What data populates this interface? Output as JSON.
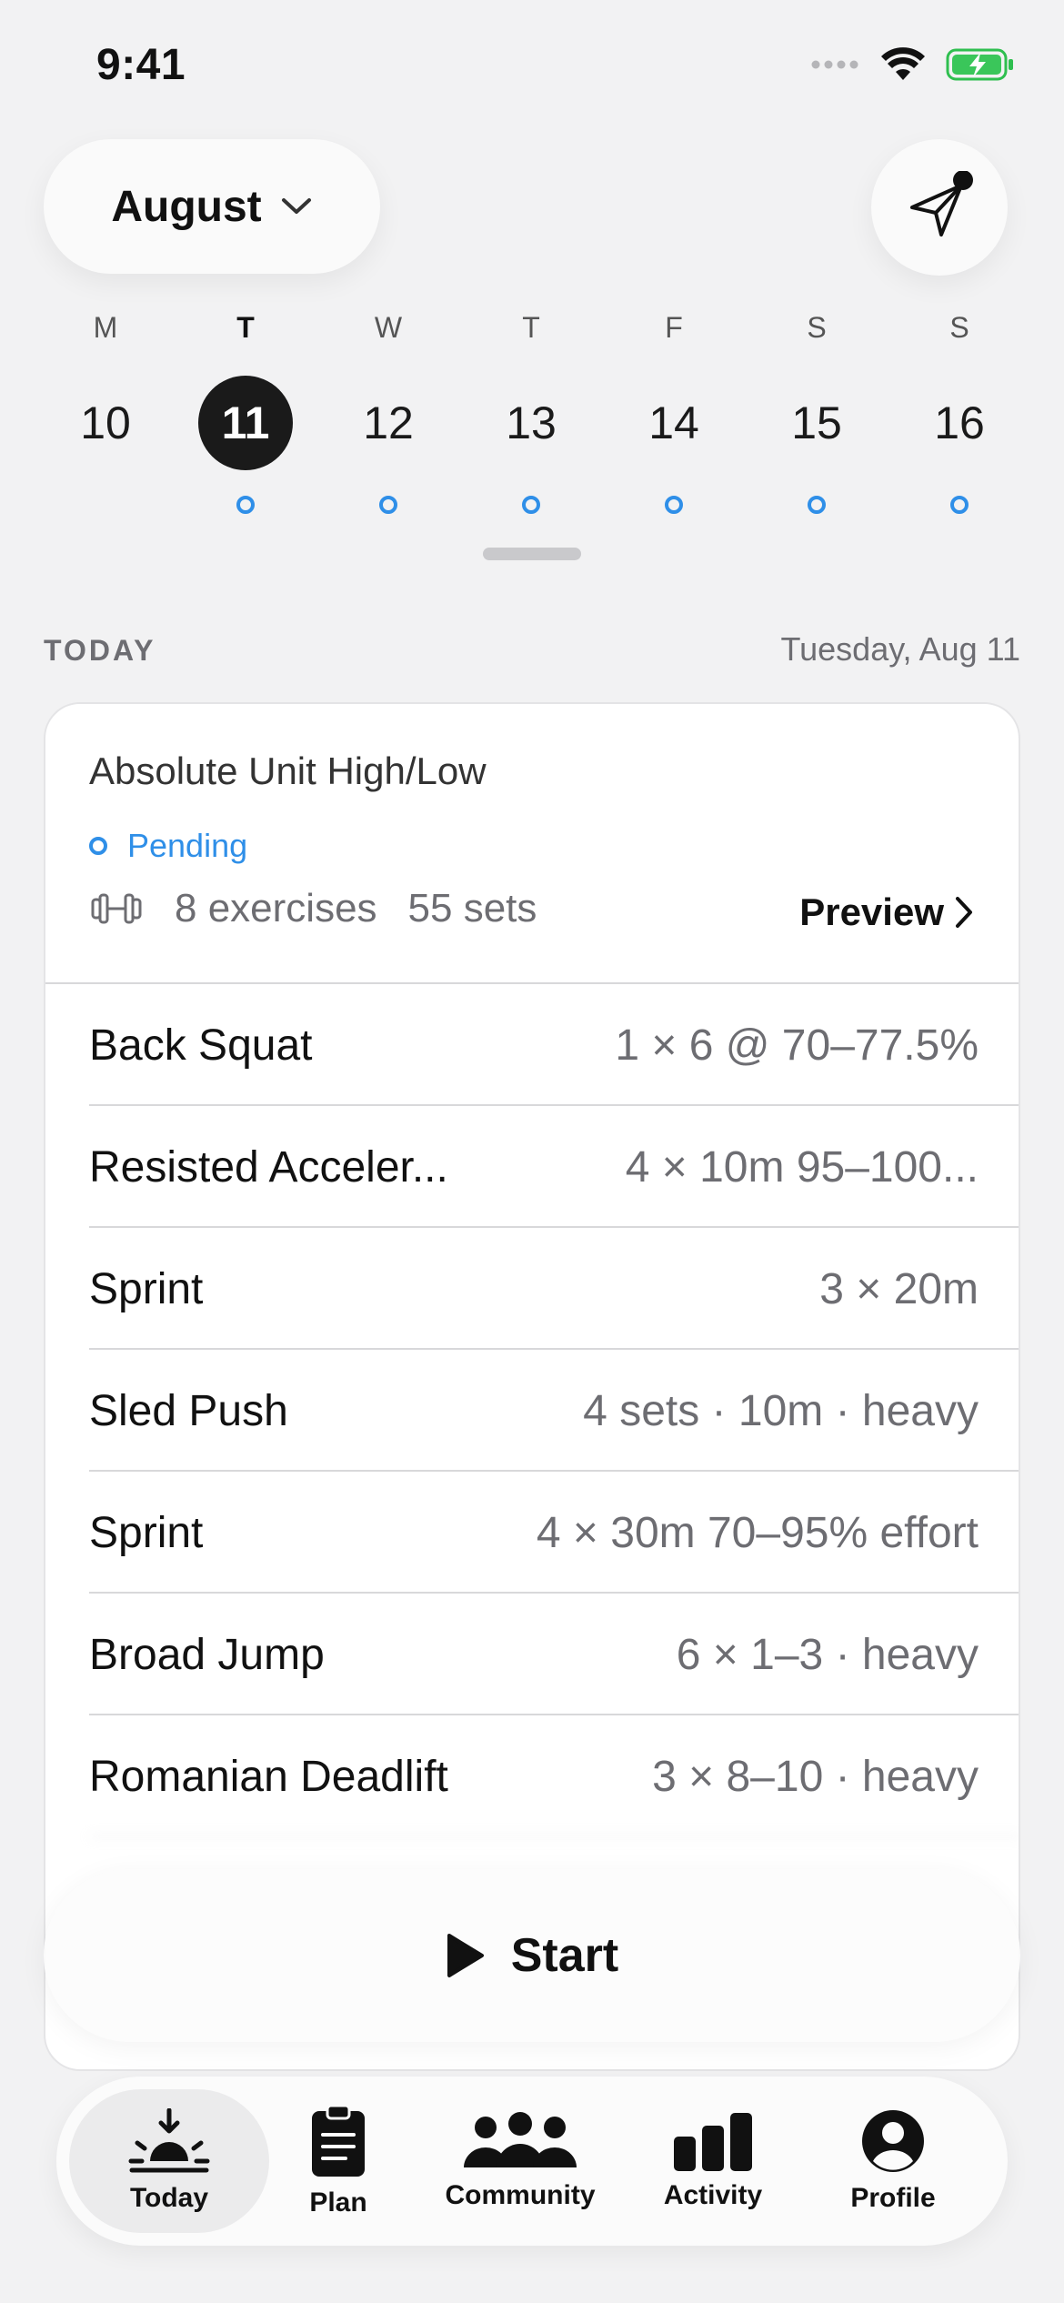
{
  "status_bar": {
    "time": "9:41"
  },
  "header": {
    "month": "August"
  },
  "week": {
    "days": [
      {
        "letter": "M",
        "num": "10"
      },
      {
        "letter": "T",
        "num": "11"
      },
      {
        "letter": "W",
        "num": "12"
      },
      {
        "letter": "T",
        "num": "13"
      },
      {
        "letter": "F",
        "num": "14"
      },
      {
        "letter": "S",
        "num": "15"
      },
      {
        "letter": "S",
        "num": "16"
      }
    ]
  },
  "section": {
    "label": "TODAY",
    "date": "Tuesday, Aug 11"
  },
  "workout": {
    "title": "Absolute Unit High/Low",
    "status": "Pending",
    "exercise_count": "8 exercises",
    "set_count": "55 sets",
    "preview_label": "Preview",
    "exercises": [
      {
        "name": "Back Squat",
        "detail": "1 × 6 @ 70–77.5%"
      },
      {
        "name": "Resisted Acceler...",
        "detail": "4 × 10m 95–100..."
      },
      {
        "name": "Sprint",
        "detail": "3 × 20m"
      },
      {
        "name": "Sled Push",
        "detail": "4 sets · 10m · heavy"
      },
      {
        "name": "Sprint",
        "detail": "4 × 30m 70–95% effort"
      },
      {
        "name": "Broad Jump",
        "detail": "6 × 1–3 · heavy"
      },
      {
        "name": "Romanian Deadlift",
        "detail": "3 × 8–10 · heavy"
      }
    ]
  },
  "start_label": "Start",
  "tabbar": {
    "tabs": [
      {
        "label": "Today",
        "icon": "sunrise-icon"
      },
      {
        "label": "Plan",
        "icon": "clipboard-icon"
      },
      {
        "label": "Community",
        "icon": "people-icon"
      },
      {
        "label": "Activity",
        "icon": "bar-chart-icon"
      },
      {
        "label": "Profile",
        "icon": "person-circle-icon"
      }
    ]
  },
  "colors": {
    "accent": "#2f8fe8",
    "selected_day": "#1a1a1a",
    "background": "#f2f2f3"
  }
}
